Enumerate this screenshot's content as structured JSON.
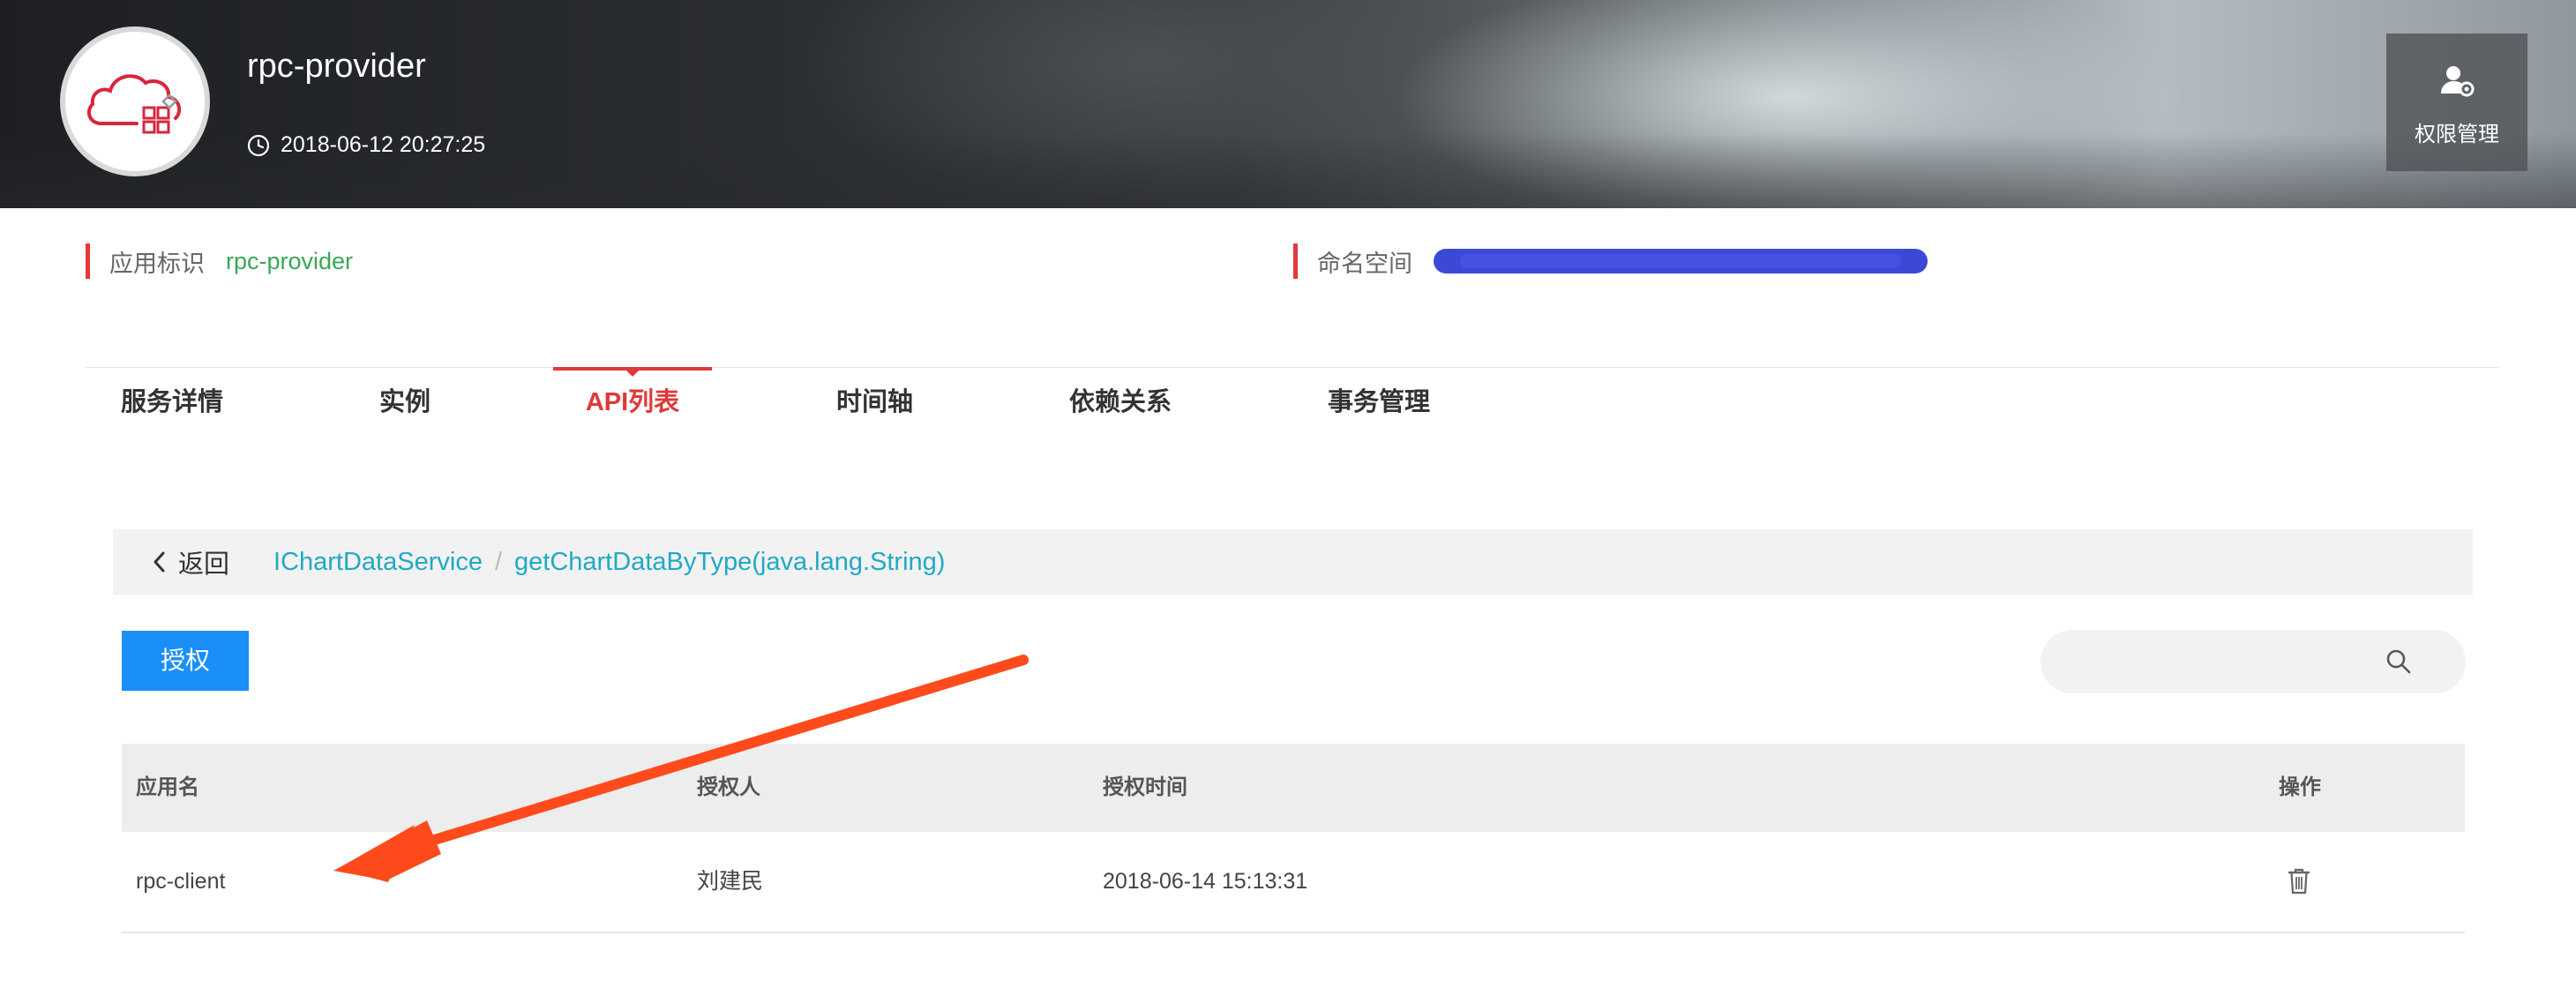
{
  "header": {
    "app_name": "rpc-provider",
    "created_time": "2018-06-12 20:27:25",
    "permission_button_label": "权限管理"
  },
  "info": {
    "app_id_label": "应用标识",
    "app_id_value": "rpc-provider",
    "namespace_label": "命名空间"
  },
  "tabs": [
    {
      "label": "服务详情",
      "active": false
    },
    {
      "label": "实例",
      "active": false
    },
    {
      "label": "API列表",
      "active": true
    },
    {
      "label": "时间轴",
      "active": false
    },
    {
      "label": "依赖关系",
      "active": false
    },
    {
      "label": "事务管理",
      "active": false
    }
  ],
  "breadcrumb": {
    "back_label": "返回",
    "items": [
      "IChartDataService",
      "getChartDataByType(java.lang.String)"
    ],
    "separator": "/"
  },
  "toolbar": {
    "authorize_label": "授权",
    "search_placeholder": "",
    "search_value": ""
  },
  "table": {
    "headers": [
      "应用名",
      "授权人",
      "授权时间",
      "操作"
    ],
    "rows": [
      {
        "app": "rpc-client",
        "grantor": "刘建民",
        "time": "2018-06-14 15:13:31",
        "action_icon": "trash-icon"
      }
    ]
  },
  "colors": {
    "accent_red": "#e23838",
    "primary_blue": "#1a8ff7",
    "link_teal": "#20a9c7",
    "value_green": "#3aa757",
    "annotation_arrow": "#ff4a1c"
  }
}
